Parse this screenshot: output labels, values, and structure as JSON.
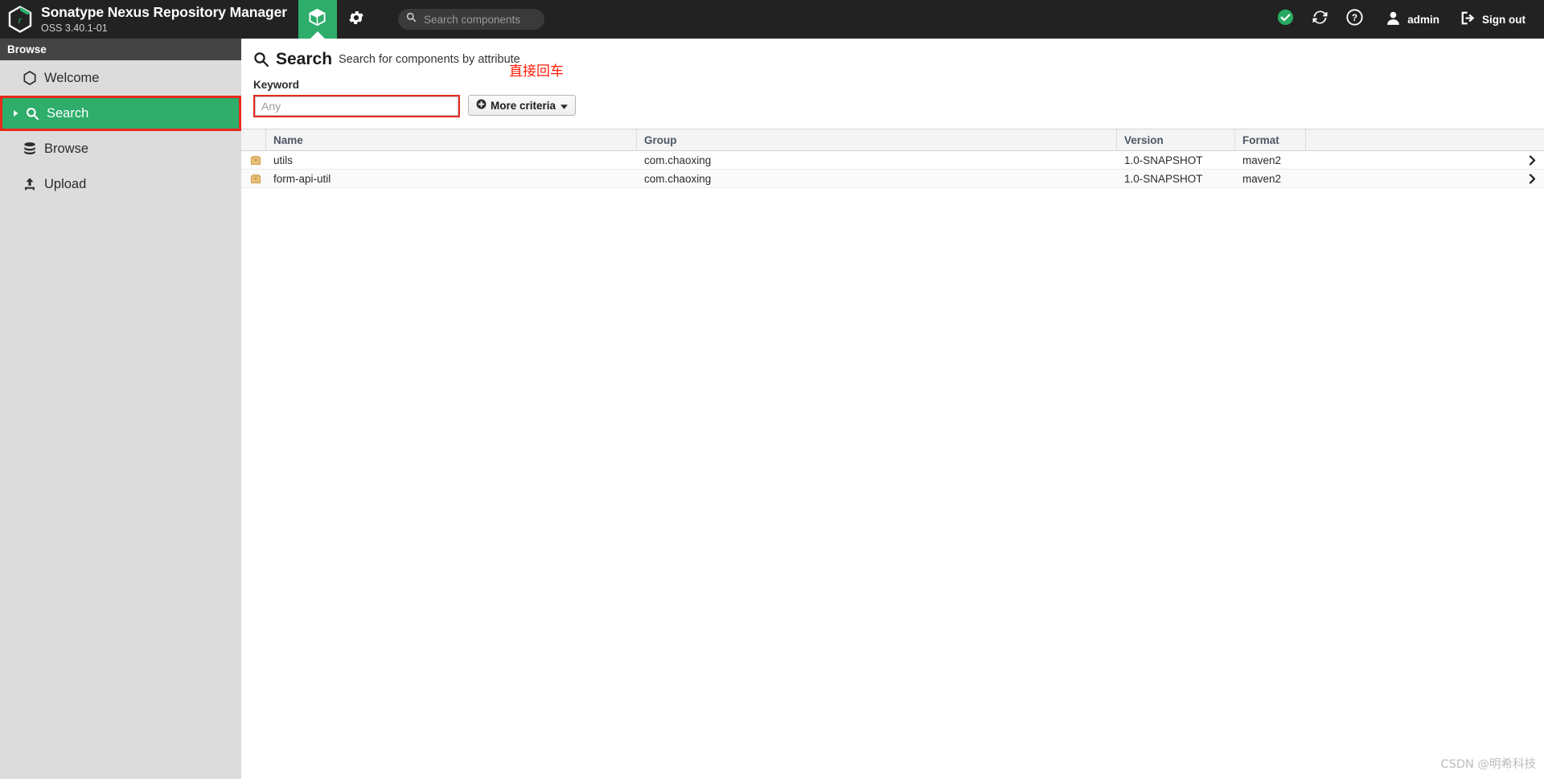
{
  "header": {
    "brand_title": "Sonatype Nexus Repository Manager",
    "brand_subtitle": "OSS 3.40.1-01",
    "logo_icon": "nexus-hexagon-logo",
    "tabs": [
      {
        "name": "browse-tab",
        "icon": "cube-box-icon",
        "active": true
      },
      {
        "name": "admin-tab",
        "icon": "gear-icon",
        "active": false
      }
    ],
    "search": {
      "placeholder": "Search components",
      "value": "",
      "icon": "search-icon"
    },
    "status_icon": "green-check-circle-icon",
    "refresh_icon": "refresh-icon",
    "help_icon": "question-mark-circle-icon",
    "user_icon": "user-avatar-icon",
    "user_label": "admin",
    "signout_icon": "sign-out-icon",
    "signout_label": "Sign out",
    "accent_green": "#2EAD6B",
    "background": "#222222"
  },
  "sidebar": {
    "section_title": "Browse",
    "items": [
      {
        "label": "Welcome",
        "icon": "hexagon-icon",
        "active": false,
        "annotated": false,
        "caret": false
      },
      {
        "label": "Search",
        "icon": "search-icon",
        "active": true,
        "annotated": true,
        "caret": true
      },
      {
        "label": "Browse",
        "icon": "database-icon",
        "active": false,
        "annotated": false,
        "caret": false
      },
      {
        "label": "Upload",
        "icon": "upload-icon",
        "active": false,
        "annotated": false,
        "caret": false
      }
    ]
  },
  "main": {
    "page_icon": "search-icon",
    "page_title": "Search",
    "page_subtitle": "Search for components by attribute",
    "keyword_label": "Keyword",
    "keyword_placeholder": "Any",
    "keyword_value": "",
    "more_criteria_label": "More criteria",
    "more_criteria_icon": "plus-circle-icon",
    "more_criteria_caret": "chevron-down-icon",
    "annotation_text": "直接回车",
    "annotation_color": "#FF1A05",
    "table": {
      "columns": [
        "Name",
        "Group",
        "Version",
        "Format"
      ],
      "rows": [
        {
          "icon": "package-icon",
          "name": "utils",
          "group": "com.chaoxing",
          "version": "1.0-SNAPSHOT",
          "format": "maven2",
          "arrow": "chevron-right-icon"
        },
        {
          "icon": "package-icon",
          "name": "form-api-util",
          "group": "com.chaoxing",
          "version": "1.0-SNAPSHOT",
          "format": "maven2",
          "arrow": "chevron-right-icon"
        }
      ]
    }
  },
  "watermark": "CSDN @明希科技"
}
